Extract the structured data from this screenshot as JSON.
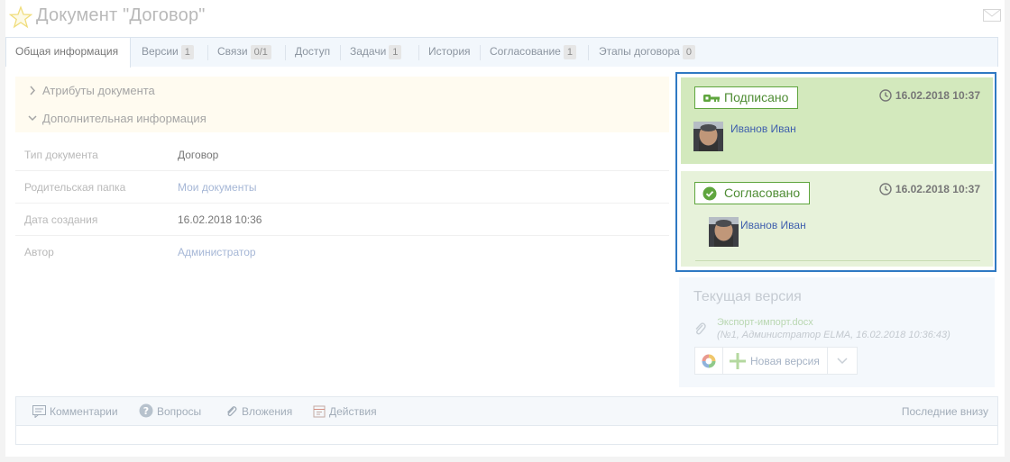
{
  "header": {
    "title": "Документ \"Договор\""
  },
  "tabs": [
    {
      "label": "Общая информация",
      "count": null,
      "active": true
    },
    {
      "label": "Версии",
      "count": "1"
    },
    {
      "label": "Связи",
      "count": "0/1"
    },
    {
      "label": "Доступ",
      "count": null
    },
    {
      "label": "Задачи",
      "count": "1"
    },
    {
      "label": "История",
      "count": null
    },
    {
      "label": "Согласование",
      "count": "1"
    },
    {
      "label": "Этапы договора",
      "count": "0"
    }
  ],
  "sections": {
    "attributes": "Атрибуты документа",
    "additional": "Дополнительная информация"
  },
  "properties": [
    {
      "label": "Тип документа",
      "value": "Договор"
    },
    {
      "label": "Родительская папка",
      "value": "Мои документы"
    },
    {
      "label": "Дата создания",
      "value": "16.02.2018 10:36"
    },
    {
      "label": "Автор",
      "value": "Администратор"
    }
  ],
  "status_cards": {
    "signed": {
      "status": "Подписано",
      "timestamp": "16.02.2018 10:37",
      "person": "Иванов Иван"
    },
    "approved": {
      "status": "Согласовано",
      "timestamp": "16.02.2018 10:37",
      "person": "Иванов Иван"
    }
  },
  "version": {
    "title": "Текущая версия",
    "file_name": "Экспорт-импорт.docx",
    "file_meta": "(№1, Администратор ELMA, 16.02.2018 10:36:43)",
    "new_version_label": "Новая версия"
  },
  "comments": {
    "tabs": [
      "Комментарии",
      "Вопросы",
      "Вложения",
      "Действия"
    ],
    "sort_label": "Последние внизу"
  },
  "colors": {
    "accent_border": "#2f79c3",
    "signed_bg": "#d3e9bd",
    "approved_bg": "#e7f2da",
    "status_green": "#5fa53e",
    "person_link": "#3f5fad"
  },
  "icons": [
    "star-icon",
    "mail-icon",
    "chevron-right-icon",
    "chevron-down-icon",
    "key-icon",
    "check-circle-icon",
    "clock-icon",
    "paperclip-icon",
    "preview-icon",
    "plus-icon",
    "chevron-down-icon",
    "comment-icon",
    "question-icon",
    "attachment-icon",
    "actions-icon"
  ]
}
